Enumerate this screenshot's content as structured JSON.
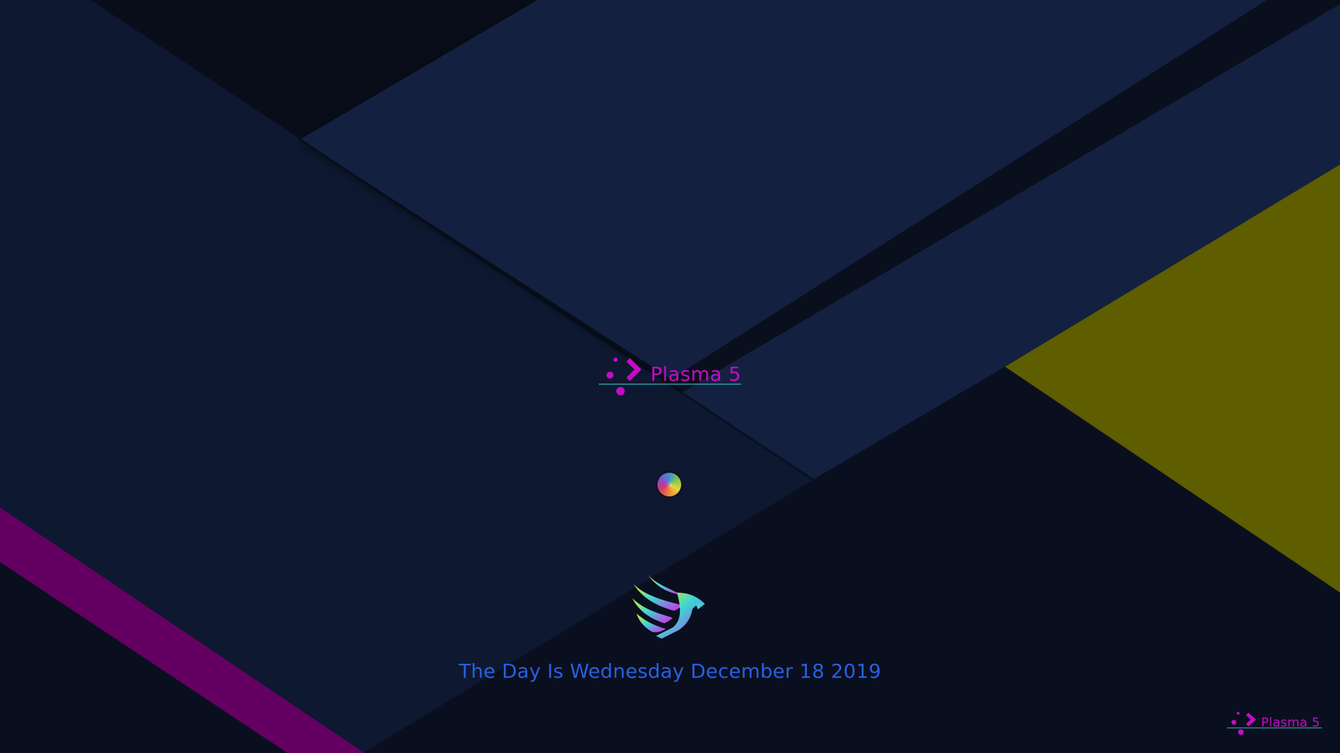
{
  "splash": {
    "brand_label": "Plasma 5",
    "date_text": "The Day Is Wednesday December 18 2019",
    "corner_brand_label": "Plasma 5"
  },
  "icons": {
    "plasma_logo": "plasma-logo-icon",
    "busy": "busy-indicator-icon",
    "distro": "winged-distro-logo-icon"
  },
  "colors": {
    "brand_magenta": "#c60bc6",
    "date_blue": "#2a5fe0",
    "underline_teal": "#2a9fa8",
    "background_navy": "#0f1a32",
    "accent_olive": "#5e5d00",
    "accent_purple": "#650063"
  }
}
